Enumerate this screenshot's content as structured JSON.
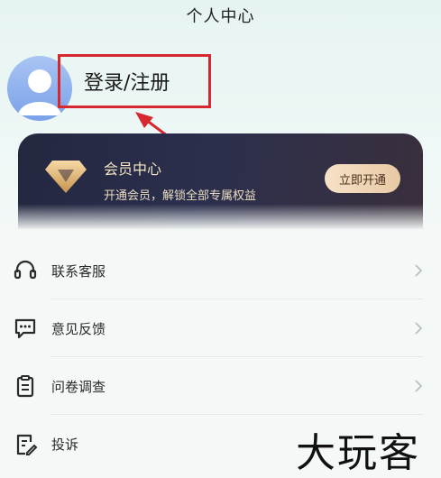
{
  "header": {
    "title": "个人中心"
  },
  "profile": {
    "login_label": "登录/注册"
  },
  "vip": {
    "title": "会员中心",
    "subtitle": "开通会员，解锁全部专属权益",
    "button": "立即开通",
    "colors": {
      "card": "#23273f",
      "gold": "#f3e4c4",
      "button": "#f6e2c8"
    }
  },
  "menu": [
    {
      "label": "联系客服",
      "icon": "headset-icon"
    },
    {
      "label": "意见反馈",
      "icon": "feedback-chat-icon"
    },
    {
      "label": "问卷调查",
      "icon": "clipboard-icon"
    },
    {
      "label": "投诉",
      "icon": "complaint-edit-icon"
    }
  ],
  "watermark": "大玩客",
  "annotation": {
    "highlight_color": "#d6282e"
  }
}
